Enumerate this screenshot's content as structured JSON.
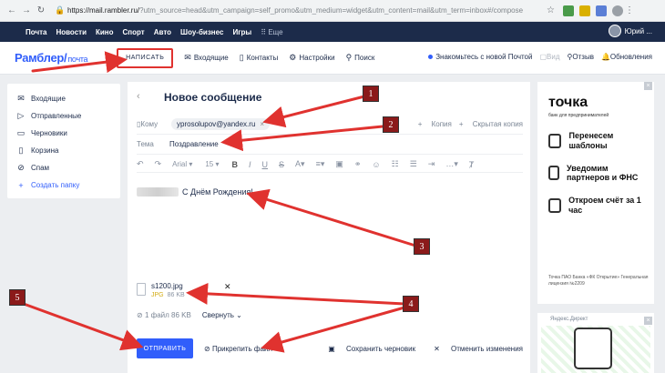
{
  "browser": {
    "url_main": "https://mail.rambler.ru/",
    "url_query": "?utm_source=head&utm_campaign=self_promo&utm_medium=widget&utm_content=mail&utm_term=inbox#/compose"
  },
  "topnav": {
    "items": [
      "Почта",
      "Новости",
      "Кино",
      "Спорт",
      "Авто",
      "Шоу-бизнес",
      "Игры"
    ],
    "more": "Еще",
    "user_name": "Юрий ..."
  },
  "header": {
    "logo": "Рамблер/",
    "logo_sub": "почта",
    "compose": "НАПИСАТЬ",
    "inbox": "Входящие",
    "contacts": "Контакты",
    "settings": "Настройки",
    "search": "Поиск",
    "new_mail": "Знакомьтесь с новой Почтой",
    "view": "Вид",
    "feedback": "Отзыв",
    "updates": "Обновления"
  },
  "sidebar": {
    "items": [
      {
        "label": "Входящие",
        "icon": "inbox-icon"
      },
      {
        "label": "Отправленные",
        "icon": "sent-icon"
      },
      {
        "label": "Черновики",
        "icon": "drafts-icon"
      },
      {
        "label": "Корзина",
        "icon": "trash-icon"
      },
      {
        "label": "Спам",
        "icon": "spam-icon"
      }
    ],
    "create_folder": "Создать папку"
  },
  "compose": {
    "title": "Новое сообщение",
    "to_label": "Кому",
    "recipient": "yprosolupov@yandex.ru",
    "cc": "Копия",
    "bcc": "Скрытая копия",
    "subject_label": "Тема",
    "subject": "Поздравление",
    "font": "Arial",
    "size": "15",
    "body": "С Днём Рождения!",
    "file_name": "s1200.jpg",
    "file_ext": "JPG",
    "file_size": "86 KB",
    "files_count": "1 файл",
    "files_total": "86 KB",
    "collapse": "Свернуть",
    "send": "ОТПРАВИТЬ",
    "attach": "Прикрепить файл",
    "save_draft": "Сохранить черновик",
    "discard": "Отменить изменения"
  },
  "ad": {
    "brand": "точка",
    "brand_sub": "банк для предпринимателей",
    "features": [
      "Перенесем шаблоны",
      "Уведомим партнеров и ФНС",
      "Откроем счёт за 1 час"
    ],
    "legal": "Точка ПАО Банка «ФК Открытие» Генеральная лицензия №2209",
    "direct_label": "Яндекс.Директ"
  },
  "annotations": [
    "1",
    "2",
    "3",
    "4",
    "5"
  ],
  "colors": {
    "nav_bg": "#1c2b4a",
    "accent": "#315efb",
    "annotation": "#e0322f"
  }
}
